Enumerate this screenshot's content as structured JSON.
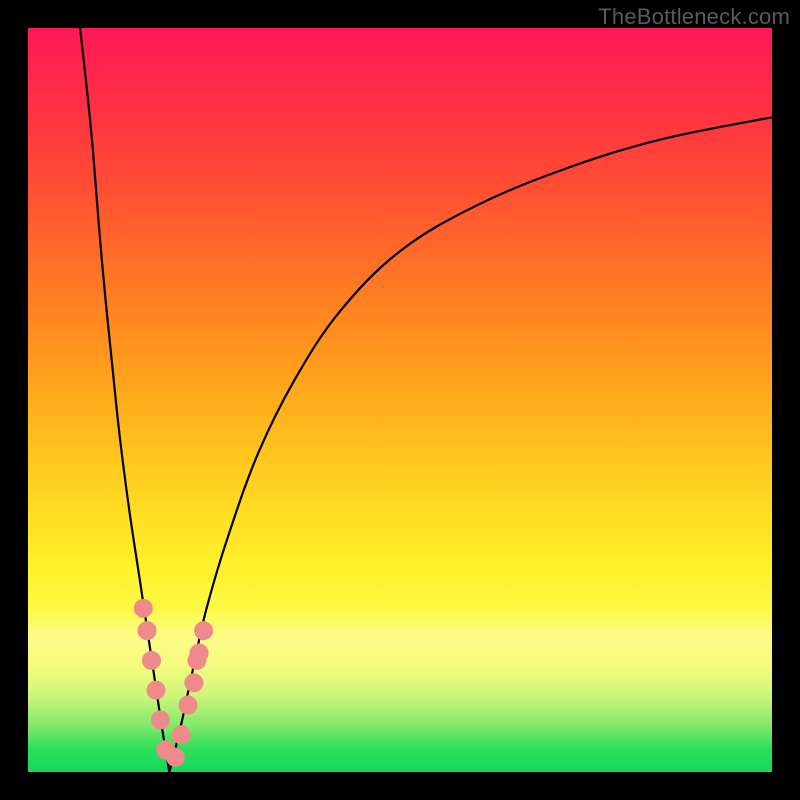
{
  "watermark": "TheBottleneck.com",
  "colors": {
    "dot": "#ef8a8a",
    "curve": "#000000",
    "frame": "#000000"
  },
  "chart_data": {
    "type": "line",
    "title": "",
    "xlabel": "",
    "ylabel": "",
    "xlim": [
      0,
      100
    ],
    "ylim": [
      0,
      100
    ],
    "grid": false,
    "legend": false,
    "notes": "V-shaped bottleneck curve on a rainbow gradient. Vertex (optimal point) sits near x≈19, y≈0. Left branch rises steeply toward y=100 at x≈7; right branch rises and asymptotes toward y≈88 as x→100. Salmon dots mark sample points clustered around the vertex on both branches, plus two loose dots just above the vertex. Values are estimated from pixel positions; no axis ticks or labels are rendered in the source image.",
    "series": [
      {
        "name": "left-branch",
        "x": [
          7.0,
          8.5,
          10.0,
          12.0,
          13.5,
          15.0,
          16.5,
          18.0,
          19.0
        ],
        "y": [
          100,
          86,
          68,
          48,
          36,
          26,
          16,
          6,
          0
        ]
      },
      {
        "name": "right-branch",
        "x": [
          19.0,
          20.5,
          22.0,
          24.0,
          27.0,
          31.0,
          36.0,
          42.0,
          50.0,
          60.0,
          72.0,
          85.0,
          100.0
        ],
        "y": [
          0,
          6,
          13,
          22,
          32,
          43,
          53,
          62,
          70,
          76,
          81,
          85,
          88
        ]
      }
    ],
    "points": [
      {
        "branch": "left",
        "x": 15.5,
        "y": 22
      },
      {
        "branch": "left",
        "x": 16.0,
        "y": 19
      },
      {
        "branch": "left",
        "x": 16.6,
        "y": 15
      },
      {
        "branch": "left",
        "x": 17.2,
        "y": 11
      },
      {
        "branch": "left",
        "x": 17.8,
        "y": 7
      },
      {
        "branch": "left",
        "x": 18.5,
        "y": 3
      },
      {
        "branch": "right",
        "x": 19.8,
        "y": 2
      },
      {
        "branch": "right",
        "x": 20.6,
        "y": 5
      },
      {
        "branch": "right",
        "x": 21.5,
        "y": 9
      },
      {
        "branch": "right",
        "x": 22.7,
        "y": 15
      },
      {
        "branch": "right",
        "x": 23.6,
        "y": 19
      },
      {
        "branch": "loose",
        "x": 22.3,
        "y": 12
      },
      {
        "branch": "loose",
        "x": 23.0,
        "y": 16
      }
    ]
  }
}
